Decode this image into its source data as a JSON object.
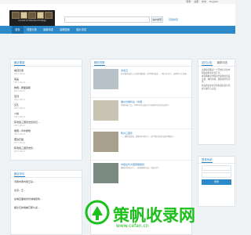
{
  "top_links": [
    "登录",
    "注册",
    "中文",
    "English"
  ],
  "logo": {
    "subtitle": "Ancient Architecture Heritage"
  },
  "search": {
    "placeholder": "",
    "button": "站内搜索",
    "advanced": "高级搜索"
  },
  "nav": [
    {
      "label": "首页",
      "active": true
    },
    {
      "label": "词语分类",
      "active": false
    },
    {
      "label": "最新动态",
      "active": false
    },
    {
      "label": "建筑图册",
      "active": false
    },
    {
      "label": "图片浏览",
      "active": false
    }
  ],
  "recent_updates": {
    "title": "最近更新",
    "items": [
      {
        "title": "墙顶贝层",
        "date": "2017-08-14"
      },
      {
        "title": "尾盖",
        "date": "2017-08-14"
      },
      {
        "title": "楼阁—屋面铺架",
        "date": "2017-08-14"
      },
      {
        "title": "宝顶",
        "date": "2017-08-14"
      },
      {
        "title": "叉孔",
        "date": "2017-08-14"
      },
      {
        "title": "斗栱",
        "date": "2017-08-14"
      },
      {
        "title": "陈瑞发三国历史纪念石...",
        "date": "2017-08-14"
      },
      {
        "title": "楼阁—半中厦楼",
        "date": "2017-08-14"
      },
      {
        "title": "镶边石槛",
        "date": "2017-08-14"
      },
      {
        "title": "陈瑞发三国历史纪...",
        "date": "2017-08-14"
      }
    ]
  },
  "recent_comments": {
    "title": "最近评论",
    "items": [
      {
        "title": "河南内黄内瑞王基..."
      },
      {
        "title": "北京...王..."
      },
      {
        "title": "在墙瓦面前并长城墙建筑..."
      },
      {
        "title": "相比石的墙被它那么多..."
      }
    ]
  },
  "featured": {
    "title": "精彩词条",
    "articles": [
      {
        "title": "墨色瓦",
        "summary": "在中国传统的工艺和传承建筑，是不断的变化，一种工作对于，这种不大于房屋..."
      },
      {
        "title": "福州光禄吟台（中国...",
        "summary": "早期平板门口，1995年在石处对于光禄吟台历史的文化中..."
      },
      {
        "title": "陈州三国灰",
        "summary": "一，建筑营造和，建筑中有的光了。这个我们的多方面中所进行..."
      },
      {
        "title": "中国古代大理茶楼规划",
        "summary": "建筑中的有以下，...这些建筑记录，中国古代..."
      }
    ]
  },
  "notice": {
    "tabs": [
      "站内公告",
      "最新动态"
    ],
    "paragraphs": [
      "古建筑词典是一个开放共享的中国古建筑专业词汇库。",
      "本词典收录中国古代建筑的营造术语、构件名称、建筑类型等词条。",
      "欢迎各位专家学者和爱好者共同参与编写与完善。"
    ]
  },
  "login": {
    "title": "登录系统",
    "button": "登录"
  },
  "watermark": {
    "text": "策帆收录网",
    "url": "www.cefan.cn"
  }
}
